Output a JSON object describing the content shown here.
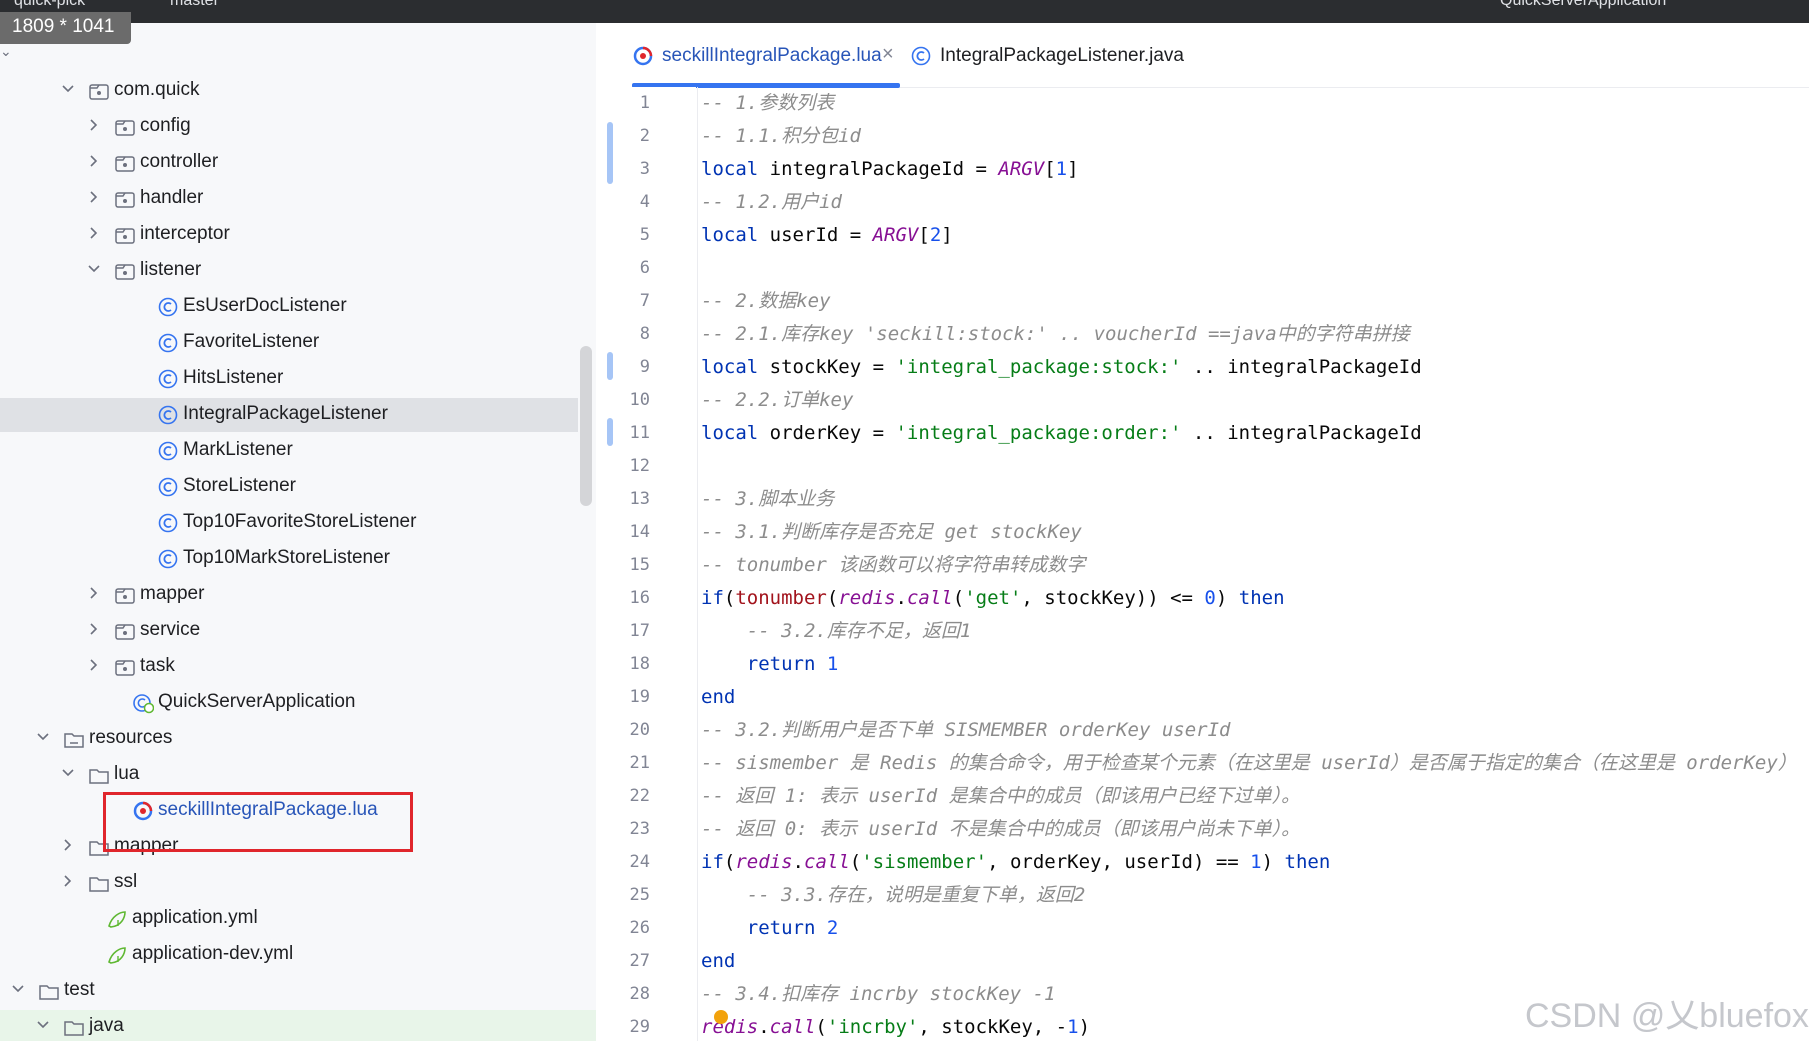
{
  "title_bar": {
    "project": "quick-pick",
    "branch": "master",
    "run_config": "QuickServerApplication"
  },
  "screenshot_badge": "1809 * 1041",
  "tree": {
    "rows": [
      {
        "label": "com.quick",
        "type": "package",
        "expanded": true
      },
      {
        "label": "config",
        "type": "package",
        "expanded": false
      },
      {
        "label": "controller",
        "type": "package",
        "expanded": false
      },
      {
        "label": "handler",
        "type": "package",
        "expanded": false
      },
      {
        "label": "interceptor",
        "type": "package",
        "expanded": false
      },
      {
        "label": "listener",
        "type": "package",
        "expanded": true
      },
      {
        "label": "EsUserDocListener",
        "type": "class"
      },
      {
        "label": "FavoriteListener",
        "type": "class"
      },
      {
        "label": "HitsListener",
        "type": "class"
      },
      {
        "label": "IntegralPackageListener",
        "type": "class",
        "selected": true
      },
      {
        "label": "MarkListener",
        "type": "class"
      },
      {
        "label": "StoreListener",
        "type": "class"
      },
      {
        "label": "Top10FavoriteStoreListener",
        "type": "class"
      },
      {
        "label": "Top10MarkStoreListener",
        "type": "class"
      },
      {
        "label": "mapper",
        "type": "package",
        "expanded": false
      },
      {
        "label": "service",
        "type": "package",
        "expanded": false
      },
      {
        "label": "task",
        "type": "package",
        "expanded": false
      },
      {
        "label": "QuickServerApplication",
        "type": "springapp"
      },
      {
        "label": "resources",
        "type": "resources",
        "expanded": true
      },
      {
        "label": "lua",
        "type": "folder",
        "expanded": true
      },
      {
        "label": "seckillIntegralPackage.lua",
        "type": "lua",
        "blue": true
      },
      {
        "label": "mapper",
        "type": "folder",
        "expanded": false
      },
      {
        "label": "ssl",
        "type": "folder",
        "expanded": false
      },
      {
        "label": "application.yml",
        "type": "yml"
      },
      {
        "label": "application-dev.yml",
        "type": "yml"
      },
      {
        "label": "test",
        "type": "folder",
        "expanded": true
      },
      {
        "label": "java",
        "type": "folder",
        "expanded": true
      }
    ]
  },
  "tabs": [
    {
      "label": "seckillIntegralPackage.lua",
      "active": true,
      "icon": "lua-icon"
    },
    {
      "label": "IntegralPackageListener.java",
      "active": false,
      "icon": "class-icon"
    }
  ],
  "editor": {
    "line_numbers": [
      "1",
      "2",
      "3",
      "4",
      "5",
      "6",
      "7",
      "8",
      "9",
      "10",
      "11",
      "12",
      "13",
      "14",
      "15",
      "16",
      "17",
      "18",
      "19",
      "20",
      "21",
      "22",
      "23",
      "24",
      "25",
      "26",
      "27",
      "28",
      "29"
    ],
    "lines": [
      [
        {
          "t": "-- 1.参数列表",
          "c": "comment"
        }
      ],
      [
        {
          "t": "-- 1.1.积分包id",
          "c": "comment"
        }
      ],
      [
        {
          "t": "local",
          "c": "kw"
        },
        {
          "t": " integralPackageId = ",
          "c": "op"
        },
        {
          "t": "ARGV",
          "c": "global"
        },
        {
          "t": "[",
          "c": "op"
        },
        {
          "t": "1",
          "c": "num"
        },
        {
          "t": "]",
          "c": "op"
        }
      ],
      [
        {
          "t": "-- 1.2.用户id",
          "c": "comment"
        }
      ],
      [
        {
          "t": "local",
          "c": "kw"
        },
        {
          "t": " userId = ",
          "c": "op"
        },
        {
          "t": "ARGV",
          "c": "global"
        },
        {
          "t": "[",
          "c": "op"
        },
        {
          "t": "2",
          "c": "num"
        },
        {
          "t": "]",
          "c": "op"
        }
      ],
      [],
      [
        {
          "t": "-- 2.数据key",
          "c": "comment"
        }
      ],
      [
        {
          "t": "-- 2.1.库存key 'seckill:stock:' .. voucherId ==java中的字符串拼接",
          "c": "comment"
        }
      ],
      [
        {
          "t": "local",
          "c": "kw"
        },
        {
          "t": " stockKey = ",
          "c": "op"
        },
        {
          "t": "'integral_package:stock:'",
          "c": "str"
        },
        {
          "t": " .. integralPackageId",
          "c": "op"
        }
      ],
      [
        {
          "t": "-- 2.2.订单key",
          "c": "comment"
        }
      ],
      [
        {
          "t": "local",
          "c": "kw"
        },
        {
          "t": " orderKey = ",
          "c": "op"
        },
        {
          "t": "'integral_package:order:'",
          "c": "str"
        },
        {
          "t": " .. integralPackageId",
          "c": "op"
        }
      ],
      [],
      [
        {
          "t": "-- 3.脚本业务",
          "c": "comment"
        }
      ],
      [
        {
          "t": "-- 3.1.判断库存是否充足 get stockKey",
          "c": "comment"
        }
      ],
      [
        {
          "t": "-- tonumber 该函数可以将字符串转成数字",
          "c": "comment"
        }
      ],
      [
        {
          "t": "if",
          "c": "kw"
        },
        {
          "t": "(",
          "c": "op"
        },
        {
          "t": "tonumber",
          "c": "builtin"
        },
        {
          "t": "(",
          "c": "op"
        },
        {
          "t": "redis",
          "c": "global"
        },
        {
          "t": ".",
          "c": "op"
        },
        {
          "t": "call",
          "c": "fn"
        },
        {
          "t": "(",
          "c": "op"
        },
        {
          "t": "'get'",
          "c": "str"
        },
        {
          "t": ", stockKey)) <= ",
          "c": "op"
        },
        {
          "t": "0",
          "c": "num"
        },
        {
          "t": ") ",
          "c": "op"
        },
        {
          "t": "then",
          "c": "kw"
        }
      ],
      [
        {
          "t": "    ",
          "c": "op"
        },
        {
          "t": "-- 3.2.库存不足，返回1",
          "c": "comment"
        }
      ],
      [
        {
          "t": "    ",
          "c": "op"
        },
        {
          "t": "return",
          "c": "kw"
        },
        {
          "t": " ",
          "c": "op"
        },
        {
          "t": "1",
          "c": "num"
        }
      ],
      [
        {
          "t": "end",
          "c": "kw"
        }
      ],
      [
        {
          "t": "-- 3.2.判断用户是否下单 SISMEMBER orderKey userId",
          "c": "comment"
        }
      ],
      [
        {
          "t": "-- sismember 是 Redis 的集合命令，用于检查某个元素（在这里是 userId）是否属于指定的集合（在这里是 orderKey）",
          "c": "comment"
        }
      ],
      [
        {
          "t": "-- 返回 1: 表示 userId 是集合中的成员（即该用户已经下过单）。",
          "c": "comment"
        }
      ],
      [
        {
          "t": "-- 返回 0: 表示 userId 不是集合中的成员（即该用户尚未下单）。",
          "c": "comment"
        }
      ],
      [
        {
          "t": "if",
          "c": "kw"
        },
        {
          "t": "(",
          "c": "op"
        },
        {
          "t": "redis",
          "c": "global"
        },
        {
          "t": ".",
          "c": "op"
        },
        {
          "t": "call",
          "c": "fn"
        },
        {
          "t": "(",
          "c": "op"
        },
        {
          "t": "'sismember'",
          "c": "str"
        },
        {
          "t": ", orderKey, userId) == ",
          "c": "op"
        },
        {
          "t": "1",
          "c": "num"
        },
        {
          "t": ") ",
          "c": "op"
        },
        {
          "t": "then",
          "c": "kw"
        }
      ],
      [
        {
          "t": "    ",
          "c": "op"
        },
        {
          "t": "-- 3.3.存在，说明是重复下单，返回2",
          "c": "comment"
        }
      ],
      [
        {
          "t": "    ",
          "c": "op"
        },
        {
          "t": "return",
          "c": "kw"
        },
        {
          "t": " ",
          "c": "op"
        },
        {
          "t": "2",
          "c": "num"
        }
      ],
      [
        {
          "t": "end",
          "c": "kw"
        }
      ],
      [
        {
          "t": "-- 3.4.扣库存 incrby stockKey -1",
          "c": "comment"
        }
      ],
      [
        {
          "t": "redis",
          "c": "global"
        },
        {
          "t": ".",
          "c": "op"
        },
        {
          "t": "call",
          "c": "fn"
        },
        {
          "t": "(",
          "c": "op"
        },
        {
          "t": "'incrby'",
          "c": "str"
        },
        {
          "t": ", stockKey, -",
          "c": "op"
        },
        {
          "t": "1",
          "c": "num"
        },
        {
          "t": ")",
          "c": "op"
        }
      ]
    ]
  },
  "watermark": "CSDN @乂bluefox"
}
